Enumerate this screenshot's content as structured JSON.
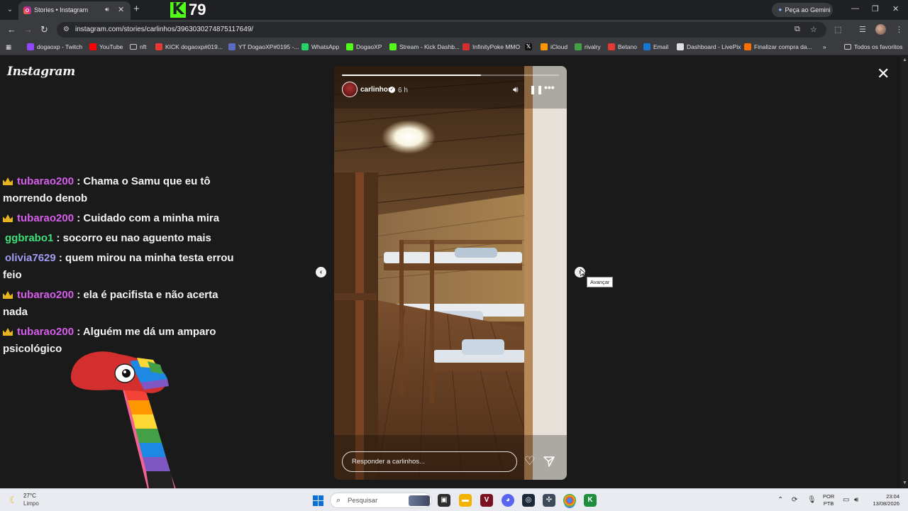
{
  "browser": {
    "tab": {
      "title": "Stories • Instagram"
    },
    "kick_badge": {
      "count": "79"
    },
    "gemini_label": "Peça ao Gemini",
    "url": "instagram.com/stories/carlinhos/3963030274875117649/"
  },
  "bookmarks": [
    {
      "label": "dogaoxp - Twitch",
      "icon_color": "#9146ff",
      "icon": "twitch-icon"
    },
    {
      "label": "YouTube",
      "icon_color": "#ff0000",
      "icon": "youtube-icon"
    },
    {
      "label": "nft",
      "icon_color": "transparent",
      "icon": "folder-icon"
    },
    {
      "label": "KICK dogaoxp#019...",
      "icon_color": "#e53935",
      "icon": "kick-icon"
    },
    {
      "label": "YT DogaoXP#0195 -...",
      "icon_color": "#5c6bc0",
      "icon": "discord-icon"
    },
    {
      "label": "WhatsApp",
      "icon_color": "#25d366",
      "icon": "whatsapp-icon"
    },
    {
      "label": "DogaoXP",
      "icon_color": "#53fc18",
      "icon": "kick-icon"
    },
    {
      "label": "Stream - Kick Dashb...",
      "icon_color": "#53fc18",
      "icon": "kick-icon"
    },
    {
      "label": "InfinityPoke MMO",
      "icon_color": "#d32f2f",
      "icon": "pokeball-icon"
    },
    {
      "label": "",
      "icon_color": "#111111",
      "icon": "x-icon"
    },
    {
      "label": "iCloud",
      "icon_color": "#ff9800",
      "icon": "icloud-icon"
    },
    {
      "label": "rivalry",
      "icon_color": "#43a047",
      "icon": "rivalry-icon"
    },
    {
      "label": "Betano",
      "icon_color": "#e53935",
      "icon": "betano-icon"
    },
    {
      "label": "Email",
      "icon_color": "#1976d2",
      "icon": "email-icon"
    },
    {
      "label": "Dashboard - LivePix",
      "icon_color": "#e0e0e0",
      "icon": "livepix-icon"
    },
    {
      "label": "Finalizar compra da...",
      "icon_color": "#ff6f00",
      "icon": "shop-icon"
    }
  ],
  "bookmarks_all": "Todos os favoritos",
  "instagram": {
    "logo": "Instagram",
    "story": {
      "username": "carlinhos",
      "time": "6 h",
      "progress": 0.64,
      "reply_placeholder": "Responder a carlinhos..."
    },
    "next_tooltip": "Avançar"
  },
  "chat": [
    {
      "badge": true,
      "user": "tubarao200",
      "color": "pink",
      "text": ": Chama o Samu que eu tô morrendo denob"
    },
    {
      "badge": true,
      "user": "tubarao200",
      "color": "pink",
      "text": ": Cuidado com a minha mira"
    },
    {
      "badge": false,
      "user": "ggbrabo1",
      "color": "green",
      "text": ": socorro eu nao aguento mais"
    },
    {
      "badge": false,
      "user": "olivia7629",
      "color": "blue",
      "text": ": quem mirou na minha testa errou feio"
    },
    {
      "badge": true,
      "user": "tubarao200",
      "color": "pink",
      "text": ": ela é pacifista e não acerta nada"
    },
    {
      "badge": true,
      "user": "tubarao200",
      "color": "pink",
      "text": ": Alguém me dá um amparo psicológico"
    }
  ],
  "taskbar": {
    "weather_temp": "27°C",
    "weather_desc": "Limpo",
    "search_placeholder": "Pesquisar",
    "lang_top": "POR",
    "lang_bottom": "PTB",
    "time": "23:04",
    "date": "13/08/2026"
  }
}
